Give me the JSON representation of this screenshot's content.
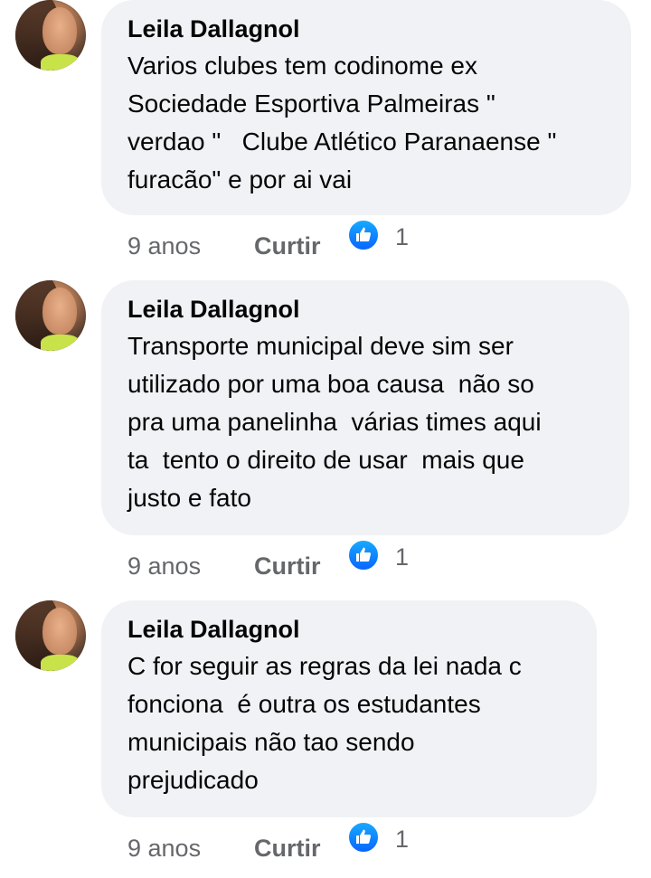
{
  "comments": [
    {
      "author": "Leila Dallagnol",
      "text": "Varios clubes tem codinome ex\nSociedade Esportiva Palmeiras \"\nverdao \"   Clube Atlético Paranaense \"\nfuracão\" e por ai vai",
      "time": "9 anos",
      "like_label": "Curtir",
      "reaction_icon": "like-icon",
      "reaction_count": "1"
    },
    {
      "author": "Leila Dallagnol",
      "text": "Transporte municipal deve sim ser\nutilizado por uma boa causa  não so\npra uma panelinha  várias times aqui\nta  tento o direito de usar  mais que\njusto e fato",
      "time": "9 anos",
      "like_label": "Curtir",
      "reaction_icon": "like-icon",
      "reaction_count": "1"
    },
    {
      "author": "Leila Dallagnol",
      "text": "C for seguir as regras da lei nada c\nfonciona  é outra os estudantes\nmunicipais não tao sendo\nprejudicado",
      "time": "9 anos",
      "like_label": "Curtir",
      "reaction_icon": "like-icon",
      "reaction_count": "1"
    }
  ],
  "colors": {
    "bubble_background": "#f0f2f5",
    "meta_text": "#65676b",
    "like_blue": "#0866ff"
  }
}
